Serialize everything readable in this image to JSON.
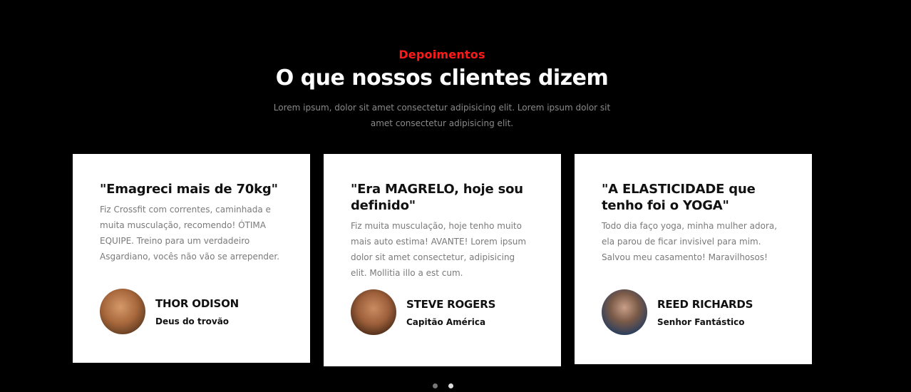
{
  "section": {
    "eyebrow": "Depoimentos",
    "title": "O que nossos clientes dizem",
    "description": "Lorem ipsum, dolor sit amet consectetur adipisicing elit. Lorem ipsum dolor sit amet consectetur adipisicing elit."
  },
  "testimonials": [
    {
      "quote": "\"Emagreci mais de 70kg\"",
      "text": "Fiz Crossfit com correntes, caminhada e muita musculação, recomendo! ÓTIMA EQUIPE. Treino para um verdadeiro Asgardiano, vocês não vão se arrepender.",
      "name": "THOR ODISON",
      "role": "Deus do trovão"
    },
    {
      "quote": "\"Era MAGRELO, hoje sou definido\"",
      "text": "Fiz muita musculação, hoje tenho muito mais auto estima! AVANTE! Lorem ipsum dolor sit amet consectetur, adipisicing elit. Mollitia illo a est cum.",
      "name": "STEVE ROGERS",
      "role": "Capitão América"
    },
    {
      "quote": "\"A ELASTICIDADE que tenho foi o YOGA\"",
      "text": "Todo dia faço yoga, minha mulher adora, ela parou de ficar invisivel para mim. Salvou meu casamento! Maravilhosos!",
      "name": "REED RICHARDS",
      "role": "Senhor Fantástico"
    }
  ],
  "carousel": {
    "page_count": 2,
    "active_index": 1
  },
  "colors": {
    "background": "#000000",
    "accent": "#ff1a1a",
    "card": "#ffffff"
  }
}
